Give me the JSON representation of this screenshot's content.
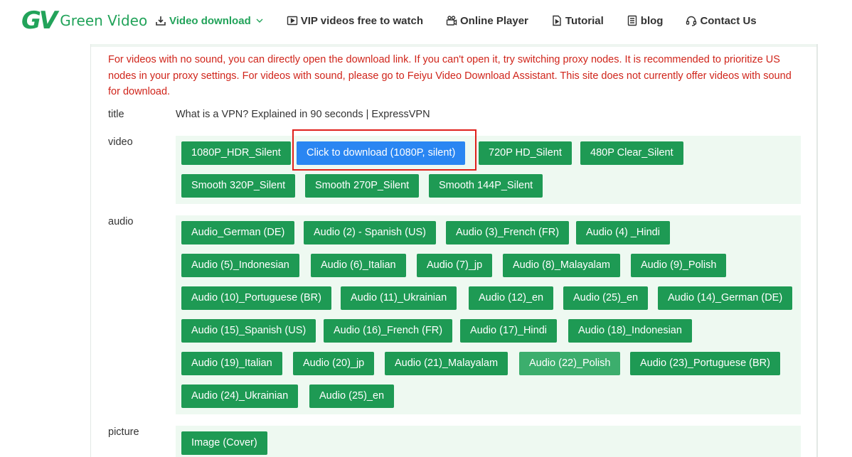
{
  "header": {
    "logo_mark": "GV",
    "logo_text": "Green Video",
    "nav": [
      {
        "label": "Video download",
        "icon": "download-icon",
        "active": true
      },
      {
        "label": "VIP videos free to watch",
        "icon": "play-icon"
      },
      {
        "label": "Online Player",
        "icon": "camera-icon"
      },
      {
        "label": "Tutorial",
        "icon": "document-play-icon"
      },
      {
        "label": "blog",
        "icon": "document-icon"
      },
      {
        "label": "Contact Us",
        "icon": "headset-icon"
      }
    ]
  },
  "notice": "For videos with no sound, you can directly open the download link. If you can't open it, try switching proxy nodes. It is recommended to prioritize US nodes in your proxy settings. For videos with sound, please go to Feiyu Video Download Assistant. This site does not currently offer videos with sound for download.",
  "labels": {
    "title": "title",
    "video": "video",
    "audio": "audio",
    "picture": "picture"
  },
  "title_value": "What is a VPN? Explained in 90 seconds | ExpressVPN",
  "video_buttons": [
    "1080P_HDR_Silent",
    "Click to download (1080P, silent)",
    "720P HD_Silent",
    "480P Clear_Silent",
    "Smooth 320P_Silent",
    "Smooth 270P_Silent",
    "Smooth 144P_Silent"
  ],
  "audio_buttons": [
    "Audio_German (DE)",
    "Audio (2) - Spanish (US)",
    "Audio (3)_French (FR)",
    "Audio (4) _Hindi",
    "Audio (5)_Indonesian",
    "Audio (6)_Italian",
    "Audio (7)_jp",
    "Audio (8)_Malayalam",
    "Audio (9)_Polish",
    "Audio (10)_Portuguese (BR)",
    "Audio (11)_Ukrainian",
    "Audio (12)_en",
    "Audio (25)_en",
    "Audio (14)_German (DE)",
    "Audio (15)_Spanish (US)",
    "Audio (16)_French (FR)",
    "Audio (17)_Hindi",
    "Audio (18)_Indonesian",
    "Audio (19)_Italian",
    "Audio (20)_jp",
    "Audio (21)_Malayalam",
    "Audio (22)_Polish",
    "Audio (23)_Portuguese (BR)",
    "Audio (24)_Ukrainian",
    "Audio (25)_en"
  ],
  "picture_buttons": [
    "Image (Cover)"
  ],
  "colors": {
    "brand_green": "#22a35a",
    "button_green": "#1e9a54",
    "button_blue": "#2a86f2",
    "notice_red": "#d0251b",
    "panel_bg": "#eef9f1"
  }
}
